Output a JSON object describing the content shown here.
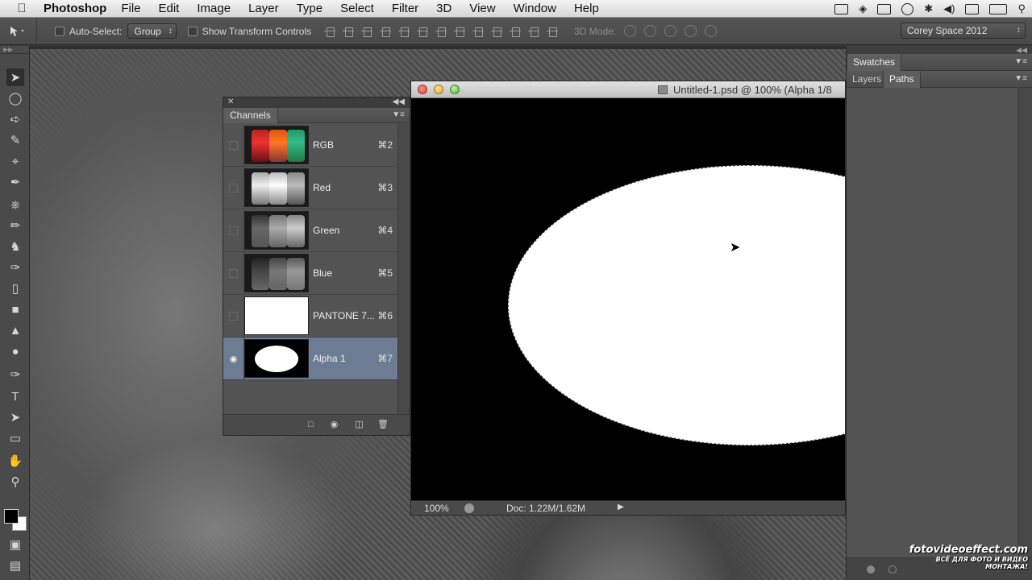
{
  "menubar": {
    "app_name": "Photoshop",
    "items": [
      "File",
      "Edit",
      "Image",
      "Layer",
      "Type",
      "Select",
      "Filter",
      "3D",
      "View",
      "Window",
      "Help"
    ],
    "status_icons": [
      "camera-icon",
      "wifi-icon",
      "display-icon",
      "time-machine-icon",
      "bluetooth-icon",
      "volume-icon",
      "calendar-icon",
      "battery-icon",
      "spotlight-icon"
    ]
  },
  "options": {
    "auto_select_label": "Auto-Select:",
    "auto_select_value": "Group",
    "transform_label": "Show Transform Controls",
    "mode3d_label": "3D Mode:",
    "workspace": "Corey Space 2012"
  },
  "channels": {
    "tab_label": "Channels",
    "rows": [
      {
        "name": "RGB",
        "shortcut": "⌘2",
        "visible": false,
        "selected": false
      },
      {
        "name": "Red",
        "shortcut": "⌘3",
        "visible": false,
        "selected": false
      },
      {
        "name": "Green",
        "shortcut": "⌘4",
        "visible": false,
        "selected": false
      },
      {
        "name": "Blue",
        "shortcut": "⌘5",
        "visible": false,
        "selected": false
      },
      {
        "name": "PANTONE 7...",
        "shortcut": "⌘6",
        "visible": false,
        "selected": false
      },
      {
        "name": "Alpha 1",
        "shortcut": "⌘7",
        "visible": true,
        "selected": true
      }
    ]
  },
  "document": {
    "title": "Untitled-1.psd @ 100% (Alpha 1/8",
    "zoom": "100%",
    "doc_info": "Doc: 1.22M/1.62M"
  },
  "right_panel": {
    "swatches_tab": "Swatches",
    "layers_tab": "Layers",
    "paths_tab": "Paths"
  },
  "watermark": {
    "main": "fotovideoeffect.com",
    "sub": "ВСЁ ДЛЯ ФОТО И ВИДЕО МОНТАЖА!"
  },
  "colors": {
    "selected_row": "#6d7c93",
    "foreground": "#000000",
    "background": "#ffffff"
  }
}
